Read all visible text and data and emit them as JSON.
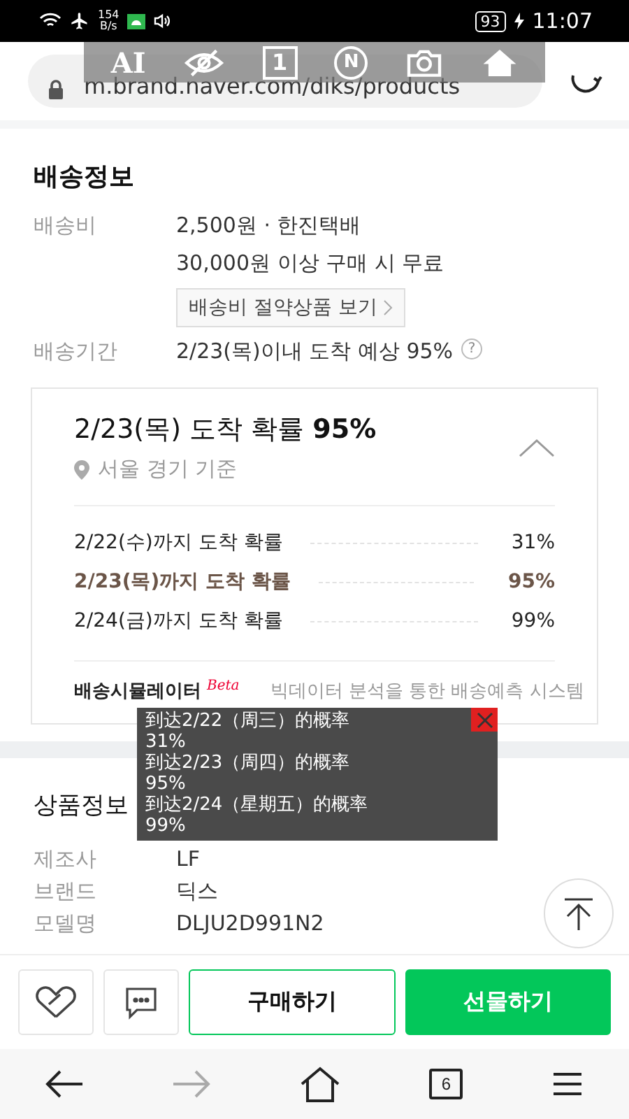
{
  "status_bar": {
    "speed": "154",
    "speed_unit": "B/s",
    "battery": "93",
    "time": "11:07"
  },
  "browser": {
    "url": "m.brand.naver.com/diks/products"
  },
  "overlay_toolbar": {
    "ai": "AI",
    "page": "1",
    "n": "N"
  },
  "delivery": {
    "title": "배송정보",
    "fee_label": "배송비",
    "fee": "2,500원  ·  한진택배",
    "free_note": "30,000원 이상 구매 시 무료",
    "saving_button": "배송비 절약상품 보기",
    "period_label": "배송기간",
    "period": "2/23(목)이내 도착 예상 95%",
    "help": "?"
  },
  "arrival_card": {
    "expanded": true,
    "headline": "2/23(목) 도착 확률 **95%**",
    "region": "서울 경기 기준",
    "rows": [
      {
        "label": "2/22(수)까지 도착 확률",
        "value": "31%",
        "highlighted": false
      },
      {
        "label": "2/23(목)까지 도착 확률",
        "value": "95%",
        "highlighted": true
      },
      {
        "label": "2/24(금)까지 도착 확률",
        "value": "99%",
        "highlighted": false
      }
    ],
    "footer_title": "배송시뮬레이터",
    "footer_badge": "Beta",
    "footer_text": "빅데이터 분석을 통한 배송예측 시스템"
  },
  "product_info": {
    "title": "상품정보",
    "rows": [
      {
        "label": "제조사",
        "value": "LF"
      },
      {
        "label": "브랜드",
        "value": "딕스"
      },
      {
        "label": "모델명",
        "value": "DLJU2D991N2"
      }
    ]
  },
  "translation_popup": {
    "lines": [
      "到达2/22（周三）的概率",
      "31%",
      "到达2/23（周四）的概率",
      "95%",
      "到达2/24（星期五）的概率",
      "99%"
    ]
  },
  "action_bar": {
    "buy": "구매하기",
    "gift": "선물하기"
  },
  "nav_bar": {
    "forward_disabled": true,
    "tab_count": "6"
  }
}
